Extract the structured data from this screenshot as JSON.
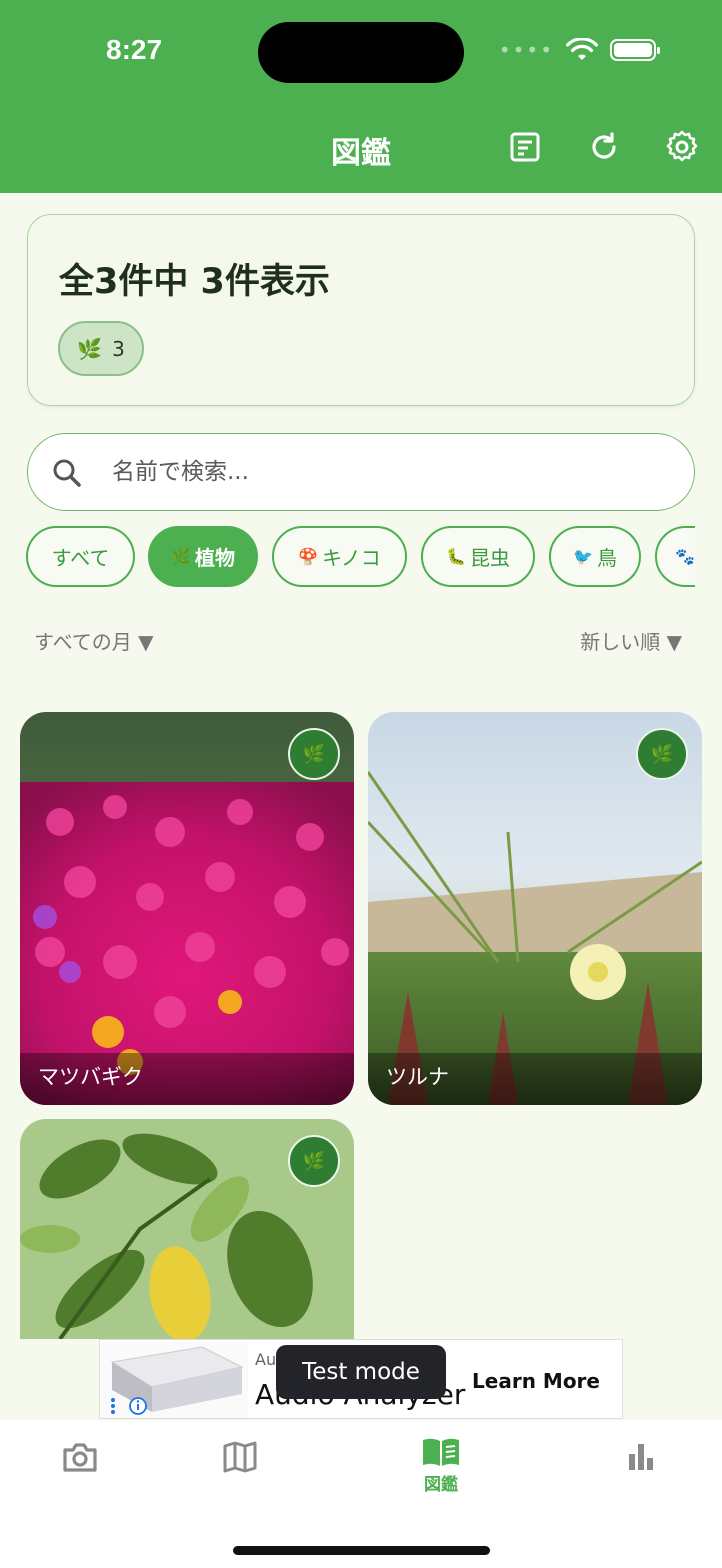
{
  "status": {
    "time": "8:27",
    "signal_dots": "••••"
  },
  "header": {
    "title": "図鑑",
    "icons": [
      "list-icon",
      "refresh-icon",
      "gear-icon"
    ]
  },
  "summary": {
    "text": "全3件中 3件表示",
    "badge_emoji": "🌿",
    "badge_count": "3"
  },
  "search": {
    "placeholder": "名前で検索..."
  },
  "chips": [
    {
      "emoji": "",
      "label": "すべて",
      "active": false
    },
    {
      "emoji": "🌿",
      "label": "植物",
      "active": true
    },
    {
      "emoji": "🍄",
      "label": "キノコ",
      "active": false
    },
    {
      "emoji": "🐛",
      "label": "昆虫",
      "active": false
    },
    {
      "emoji": "🐦",
      "label": "鳥",
      "active": false
    },
    {
      "emoji": "🐾",
      "label": "",
      "active": false
    }
  ],
  "filters": {
    "month": "すべての月 ▼",
    "sort": "新しい順 ▼"
  },
  "cards": [
    {
      "name": "マツバギク",
      "category_emoji": "🌿"
    },
    {
      "name": "ツルナ",
      "category_emoji": "🌿"
    },
    {
      "name": "",
      "category_emoji": "🌿"
    }
  ],
  "ad": {
    "title_small": "Au",
    "title": "Audio Analyzer",
    "cta": "Learn More",
    "toast": "Test mode"
  },
  "nav": {
    "items": [
      {
        "icon": "camera-icon",
        "label": ""
      },
      {
        "icon": "map-icon",
        "label": ""
      },
      {
        "icon": "book-icon",
        "label": "図鑑",
        "active": true
      },
      {
        "icon": "bar-chart-icon",
        "label": ""
      }
    ]
  },
  "colors": {
    "primary": "#4caf50",
    "dark_green": "#2e7d32",
    "background": "#f6f9ee"
  }
}
